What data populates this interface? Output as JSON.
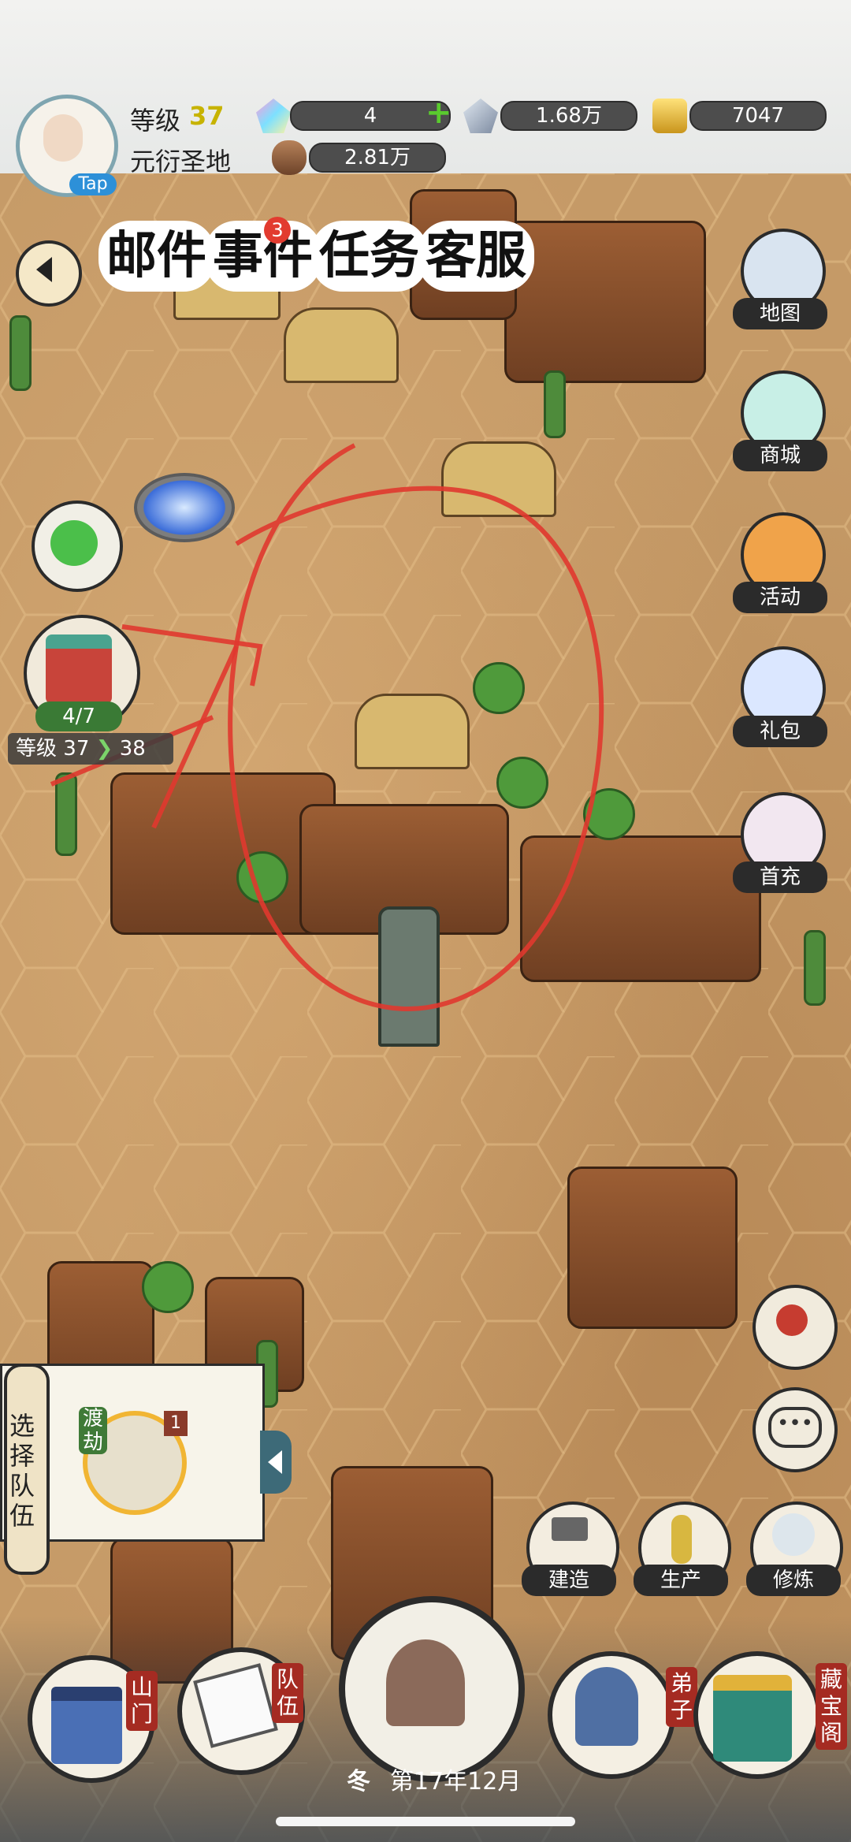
{
  "profile": {
    "level_label": "等级",
    "level_value": "37",
    "sect_name": "元衍圣地",
    "avatar_badge": "Tap"
  },
  "resources": {
    "spirit_stone": "4",
    "crystal": "1.68万",
    "gold": "7047",
    "wood": "2.81万"
  },
  "tabs": {
    "mail": "邮件",
    "events": "事件",
    "events_badge": "3",
    "tasks": "任务",
    "guest": "客服"
  },
  "right_menu": {
    "map": "地图",
    "shop": "商城",
    "activity": "活动",
    "gift": "礼包",
    "first_recharge": "首充"
  },
  "building": {
    "progress": "4/7",
    "level_label": "等级",
    "level_current": "37",
    "level_next": "38"
  },
  "team_panel": {
    "select_label": "选择队伍",
    "tag": "渡劫",
    "flag": "1"
  },
  "tools": {
    "build": "建造",
    "produce": "生产",
    "cultivate": "修炼"
  },
  "bottom_nav": {
    "gate": "山门",
    "team": "队伍",
    "disciple": "弟子",
    "treasure": "藏宝阁"
  },
  "season": {
    "season": "冬",
    "date": "第17年12月"
  },
  "colors": {
    "ground": "#c59a67",
    "rock": "#8a5230",
    "annotation_red": "#e0392f",
    "label_bg": "#2b2b2b"
  }
}
